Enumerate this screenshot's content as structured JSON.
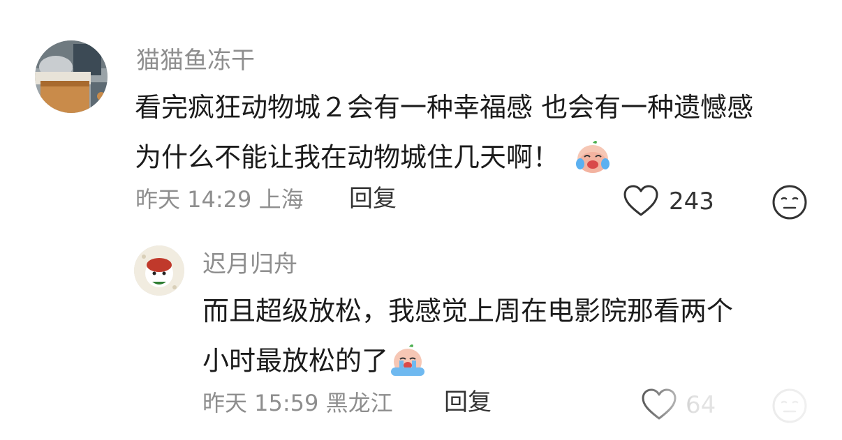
{
  "comments": [
    {
      "username": "猫猫鱼冻干",
      "content_lines": [
        "看完疯狂动物城２会有一种幸福感 也会有一种遗憾感",
        "为什么不能让我在动物城住几天啊！"
      ],
      "time": "昨天 14:29 上海",
      "reply_label": "回复",
      "likes": "243"
    },
    {
      "username": "迟月归舟",
      "content_lines": [
        "而且超级放松，我感觉上周在电影院那看两个",
        "小时最放松的了"
      ],
      "time": "昨天 15:59 黑龙江",
      "reply_label": "回复",
      "likes": "64"
    }
  ],
  "colors": {
    "username": "#8e8e8e",
    "content": "#1b1b1b",
    "meta": "#8e8e8e",
    "action": "#333333"
  },
  "icons": {
    "like": "heart-outline-icon",
    "react": "smiley-face-icon",
    "emoji_1": "crying-laughing-emoji",
    "emoji_2": "crying-emoji"
  }
}
